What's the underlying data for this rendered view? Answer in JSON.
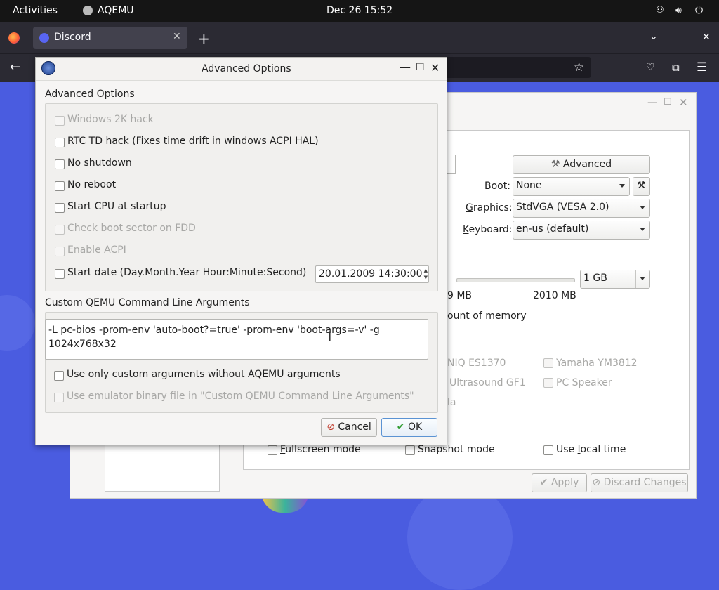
{
  "topbar": {
    "activities": "Activities",
    "app_name": "AQEMU",
    "clock": "Dec 26  15:52"
  },
  "browser": {
    "tab_title": "Discord",
    "new_tab": "+"
  },
  "main_window": {
    "advanced_button": "Advanced",
    "boot_label": "Boot:",
    "boot_value": "None",
    "graphics_label": "Graphics:",
    "graphics_value": "StdVGA (VESA 2.0)",
    "keyboard_label": "Keyboard:",
    "keyboard_value": "en-us (default)",
    "memory_value": "1 GB",
    "memory_min_partial": "9 MB",
    "memory_max": "2010 MB",
    "memory_note_partial": "ount of memory",
    "sound_es1370_partial": "NIQ ES1370",
    "sound_ym3812": "Yamaha YM3812",
    "sound_gf1_partial": "Ultrasound GF1",
    "sound_pcspk": "PC Speaker",
    "sound_partial3": "la",
    "fullscreen": "Fullscreen mode",
    "snapshot": "Snapshot mode",
    "local_time": "Use local time",
    "apply": "Apply",
    "discard": "Discard Changes"
  },
  "dialog": {
    "title": "Advanced Options",
    "group1_title": "Advanced Options",
    "options": [
      {
        "label": "Windows 2K hack",
        "enabled": false
      },
      {
        "label": "RTC TD hack (Fixes time drift in windows ACPI HAL)",
        "enabled": true
      },
      {
        "label": "No shutdown",
        "enabled": true
      },
      {
        "label": "No reboot",
        "enabled": true
      },
      {
        "label": "Start CPU at startup",
        "enabled": true
      },
      {
        "label": "Check boot sector on FDD",
        "enabled": false
      },
      {
        "label": "Enable ACPI",
        "enabled": false
      },
      {
        "label": "Start date (Day.Month.Year Hour:Minute:Second)",
        "enabled": true
      }
    ],
    "start_date_value": "20.01.2009 14:30:00",
    "group2_title": "Custom QEMU Command Line Arguments",
    "custom_args": "-L pc-bios -prom-env 'auto-boot?=true' -prom-env 'boot-args=-v' -g 1024x768x32",
    "use_only_custom": "Use only custom arguments without AQEMU arguments",
    "use_emulator_binary": "Use emulator binary file in \"Custom QEMU Command Line Arguments\"",
    "cancel": "Cancel",
    "ok": "OK"
  }
}
